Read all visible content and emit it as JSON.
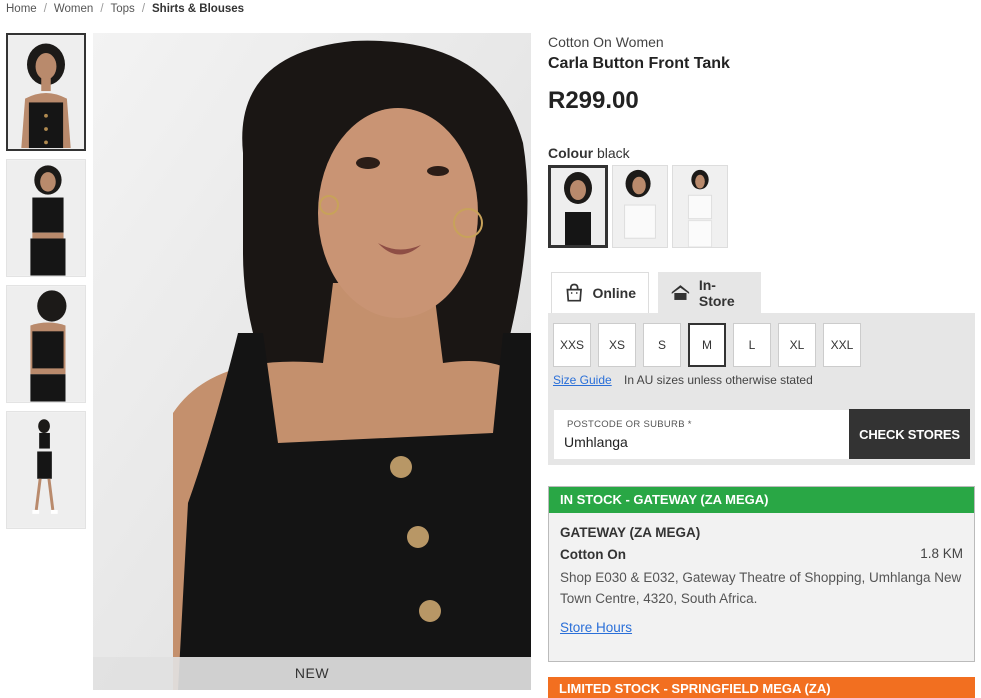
{
  "breadcrumb": {
    "home": "Home",
    "women": "Women",
    "tops": "Tops",
    "current": "Shirts & Blouses",
    "separator": "/"
  },
  "gallery": {
    "badge": "NEW",
    "thumbnails": [
      "front-black",
      "side-black",
      "back-black",
      "full-length-black"
    ]
  },
  "product": {
    "brand": "Cotton On Women",
    "name": "Carla Button Front Tank",
    "price": "R299.00",
    "colour_label": "Colour",
    "colour_value": "black",
    "swatches": [
      "black",
      "white",
      "white-alt"
    ]
  },
  "tabs": {
    "online": "Online",
    "instore": "In-Store",
    "online_icon": "shopping-bag-icon",
    "instore_icon": "store-icon"
  },
  "sizes": {
    "options": [
      "XXS",
      "XS",
      "S",
      "M",
      "L",
      "XL",
      "XXL"
    ],
    "selected": "M",
    "guide_label": "Size Guide",
    "note": "In AU sizes unless otherwise stated"
  },
  "store_search": {
    "label": "POSTCODE OR SUBURB *",
    "value": "Umhlanga",
    "button": "CHECK STORES"
  },
  "results": [
    {
      "status": "IN STOCK - GATEWAY (ZA MEGA)",
      "status_color": "#29a745",
      "store_name": "GATEWAY (ZA MEGA)",
      "brand": "Cotton On",
      "distance": "1.8 KM",
      "address": "Shop E030 & E032, Gateway Theatre of Shopping, Umhlanga New Town Centre, 4320, South Africa.",
      "hours_label": "Store Hours"
    },
    {
      "status": "LIMITED STOCK - SPRINGFIELD MEGA (ZA)",
      "status_color": "#f26f20"
    }
  ],
  "colors": {
    "accent_dark": "#333333",
    "link": "#2a6fd8",
    "in_stock": "#29a745",
    "limited_stock": "#f26f20"
  }
}
